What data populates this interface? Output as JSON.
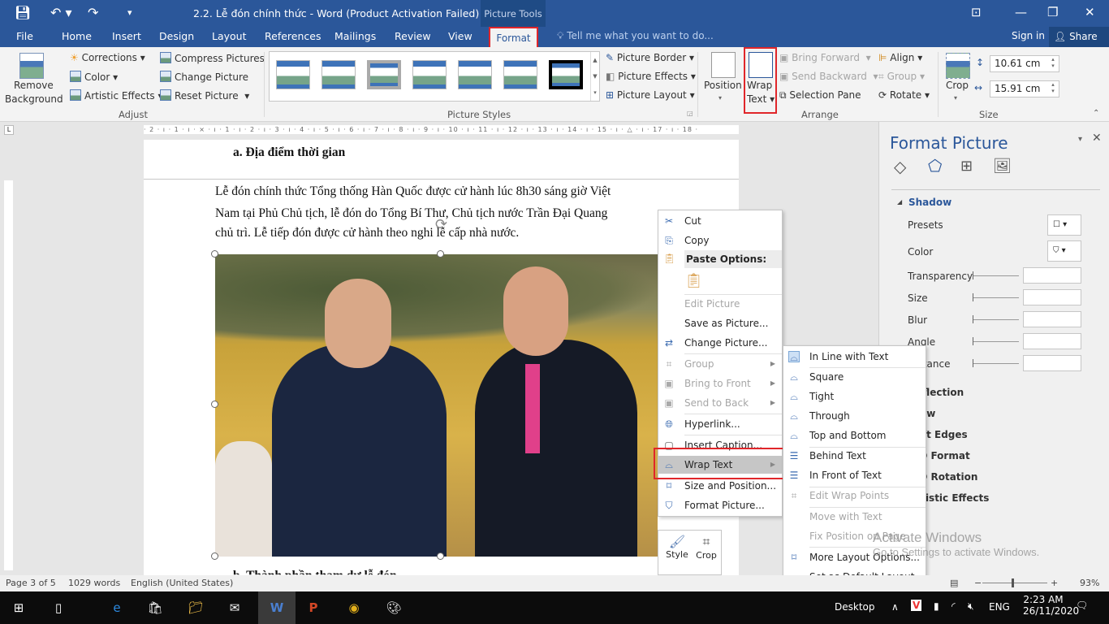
{
  "titlebar": {
    "title": "2.2. Lễ đón chính thức - Word (Product Activation Failed)",
    "context_tab_group": "Picture Tools"
  },
  "tabs": [
    "File",
    "Home",
    "Insert",
    "Design",
    "Layout",
    "References",
    "Mailings",
    "Review",
    "View",
    "Format"
  ],
  "active_tab": "Format",
  "tell_me": "Tell me what you want to do...",
  "sign_in": "Sign in",
  "share": "Share",
  "ribbon": {
    "adjust": {
      "label": "Adjust",
      "remove_bg_1": "Remove",
      "remove_bg_2": "Background",
      "corrections": "Corrections",
      "color": "Color",
      "artistic": "Artistic Effects",
      "compress": "Compress Pictures",
      "change": "Change Picture",
      "reset": "Reset Picture"
    },
    "styles": {
      "label": "Picture Styles",
      "border": "Picture Border",
      "effects": "Picture Effects",
      "layout": "Picture Layout"
    },
    "arrange": {
      "label": "Arrange",
      "position": "Position",
      "wrap_1": "Wrap",
      "wrap_2": "Text",
      "bring_forward": "Bring Forward",
      "send_backward": "Send Backward",
      "selection_pane": "Selection Pane",
      "align": "Align",
      "group": "Group",
      "rotate": "Rotate"
    },
    "size": {
      "label": "Size",
      "crop": "Crop",
      "height": "10.61 cm",
      "width": "15.91 cm"
    }
  },
  "ruler": "· 2 · ı · 1 · ı · ⨯ · ı · 1 · ı · 2 · ı · 3 · ı · 4 · ı · 5 · ı · 6 · ı · 7 · ı · 8 · ı · 9 · ı · 10 · ı · 11 · ı · 12 · ı · 13 · ı · 14 · ı · 15 · ı · △ · ı · 17 · ı · 18 ·",
  "document": {
    "heading": "a.  Địa điểm thời gian",
    "lines": [
      "Lễ đón chính thức Tổng thống Hàn Quốc được cử hành lúc 8h30 sáng giờ Việt",
      "Nam tại Phủ Chủ tịch, lễ đón do Tổng Bí Thư, Chủ tịch nước Trần Đại Quang",
      "chủ trì. Lễ tiếp đón được cử hành theo nghi lễ cấp nhà nước."
    ],
    "next_heading_partial": "b.  Thành phần tham dự lễ đón"
  },
  "context_menu": {
    "items": [
      {
        "label": "Cut",
        "icon": "scissors-icon",
        "disabled": false
      },
      {
        "label": "Copy",
        "icon": "copy-icon",
        "disabled": false
      },
      {
        "label": "Paste Options:",
        "icon": "paste-icon",
        "disabled": false
      },
      {
        "label": "Edit Picture",
        "disabled": true
      },
      {
        "label": "Save as Picture...",
        "disabled": false
      },
      {
        "label": "Change Picture...",
        "icon": "change-picture-icon",
        "disabled": false
      },
      {
        "label": "Group",
        "icon": "group-icon",
        "disabled": true
      },
      {
        "label": "Bring to Front",
        "icon": "bring-front-icon",
        "disabled": true
      },
      {
        "label": "Send to Back",
        "icon": "send-back-icon",
        "disabled": true
      },
      {
        "label": "Hyperlink...",
        "icon": "hyperlink-icon",
        "disabled": false
      },
      {
        "label": "Insert Caption...",
        "icon": "caption-icon",
        "disabled": false
      },
      {
        "label": "Wrap Text",
        "icon": "wrap-text-icon",
        "disabled": false,
        "highlighted": true
      },
      {
        "label": "Size and Position...",
        "icon": "size-position-icon",
        "disabled": false
      },
      {
        "label": "Format Picture...",
        "icon": "format-picture-icon",
        "disabled": false
      }
    ]
  },
  "wrap_submenu": {
    "items": [
      {
        "label": "In Line with Text",
        "disabled": false,
        "selected": true
      },
      {
        "label": "Square",
        "disabled": false
      },
      {
        "label": "Tight",
        "disabled": false
      },
      {
        "label": "Through",
        "disabled": false
      },
      {
        "label": "Top and Bottom",
        "disabled": false
      },
      {
        "label": "Behind Text",
        "disabled": false
      },
      {
        "label": "In Front of Text",
        "disabled": false
      },
      {
        "label": "Edit Wrap Points",
        "disabled": true
      },
      {
        "label": "Move with Text",
        "disabled": true
      },
      {
        "label": "Fix Position on Page",
        "disabled": true
      },
      {
        "label": "More Layout Options...",
        "disabled": false
      },
      {
        "label": "Set as Default Layout",
        "disabled": false
      }
    ]
  },
  "mini_toolbar": {
    "style": "Style",
    "crop": "Crop"
  },
  "format_pane": {
    "title": "Format Picture",
    "section": "Shadow",
    "fields": [
      "Presets",
      "Color",
      "Transparency",
      "Size",
      "Blur",
      "Angle",
      "Distance"
    ],
    "sections": [
      "Reflection",
      "Glow",
      "Soft Edges",
      "3-D Format",
      "3-D Rotation",
      "Artistic Effects"
    ]
  },
  "status": {
    "page": "Page 3 of 5",
    "words": "1029 words",
    "language": "English (United States)",
    "zoom": "93%",
    "zoom_percent": 93
  },
  "taskbar": {
    "desktop": "Desktop",
    "lang": "ENG",
    "time": "2:23 AM",
    "date": "26/11/2020"
  },
  "watermark": {
    "line1": "Activate Windows",
    "line2": "Go to Settings to activate Windows."
  },
  "colors": {
    "word_blue": "#2b579a",
    "highlight_red": "#e0262a",
    "pane_title": "#2b579a"
  }
}
